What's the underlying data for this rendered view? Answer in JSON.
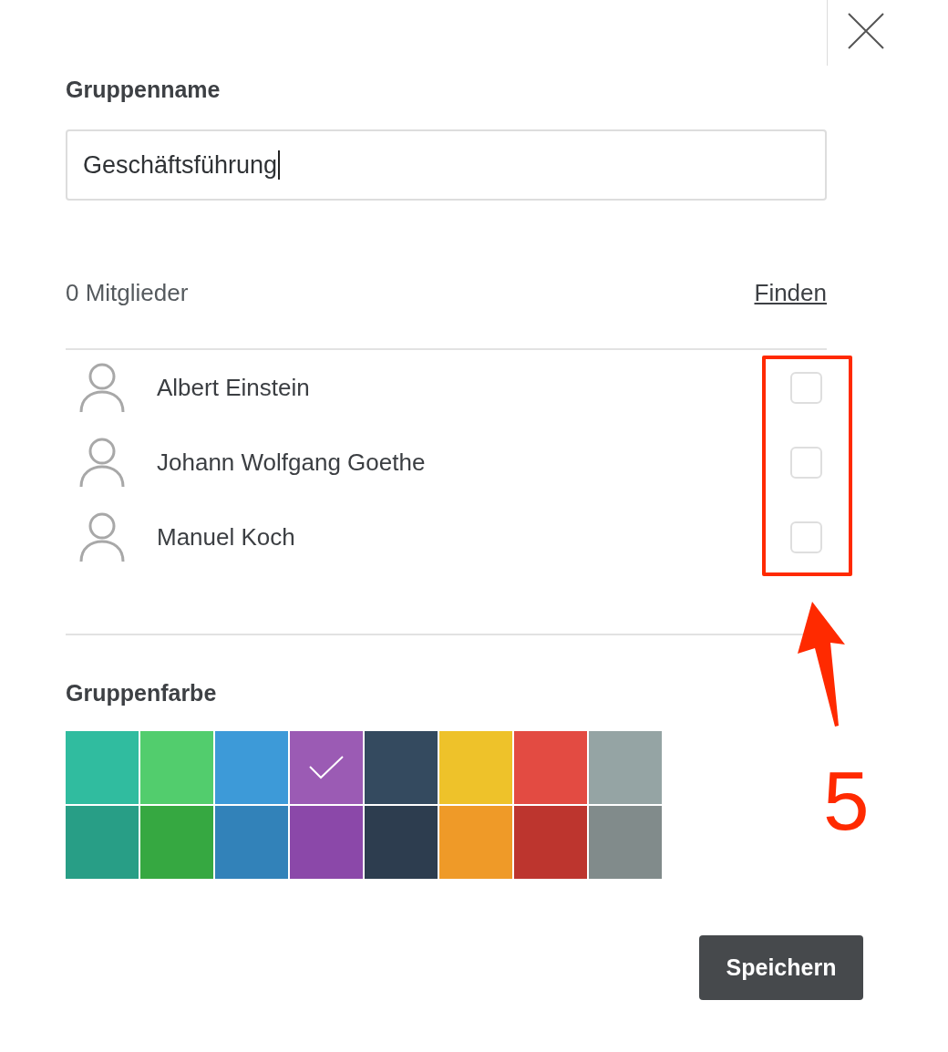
{
  "group_name": {
    "label": "Gruppenname",
    "value": "Geschäftsführung",
    "focused": true
  },
  "members": {
    "count": "0 Mitglieder",
    "find_link": "Finden",
    "people": [
      {
        "name": "Albert Einstein",
        "checked": false
      },
      {
        "name": "Johann Wolfgang Goethe",
        "checked": false
      },
      {
        "name": "Manuel Koch",
        "checked": false
      }
    ]
  },
  "group_color": {
    "label": "Gruppenfarbe",
    "swatches": [
      {
        "color": "#30bc9f",
        "selected": false
      },
      {
        "color": "#52cd6d",
        "selected": false
      },
      {
        "color": "#3d9ad8",
        "selected": false
      },
      {
        "color": "#9b5bb4",
        "selected": true
      },
      {
        "color": "#344a5f",
        "selected": false
      },
      {
        "color": "#eec22a",
        "selected": false
      },
      {
        "color": "#e34b42",
        "selected": false
      },
      {
        "color": "#95a4a4",
        "selected": false
      },
      {
        "color": "#289e86",
        "selected": false
      },
      {
        "color": "#36a841",
        "selected": false
      },
      {
        "color": "#3282b9",
        "selected": false
      },
      {
        "color": "#8b48a9",
        "selected": false
      },
      {
        "color": "#2d3d4f",
        "selected": false
      },
      {
        "color": "#ef9a28",
        "selected": false
      },
      {
        "color": "#bd352e",
        "selected": false
      },
      {
        "color": "#818b8b",
        "selected": false
      }
    ]
  },
  "save_button": "Speichern",
  "annotation": {
    "label": "5"
  }
}
